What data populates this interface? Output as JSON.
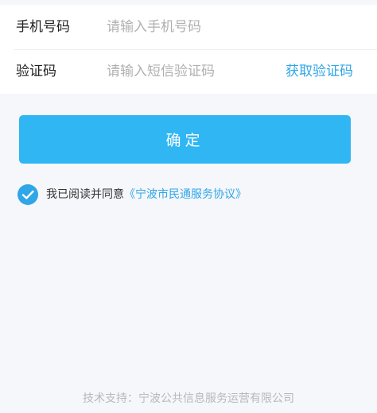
{
  "form": {
    "phone": {
      "label": "手机号码",
      "value": "",
      "placeholder": "请输入手机号码"
    },
    "code": {
      "label": "验证码",
      "value": "",
      "placeholder": "请输入短信验证码",
      "get_code_label": "获取验证码"
    }
  },
  "confirm_button": {
    "label": "确定"
  },
  "agreement": {
    "checked": true,
    "prefix": "我已阅读并同意",
    "link_text": "《宁波市民通服务协议》"
  },
  "footer": {
    "text": "技术支持：宁波公共信息服务运营有限公司"
  },
  "colors": {
    "accent": "#2fa6e8",
    "button": "#2fb6f3",
    "background": "#f5f7fb"
  },
  "icons": {
    "agreement_check": "check-circle-icon"
  }
}
